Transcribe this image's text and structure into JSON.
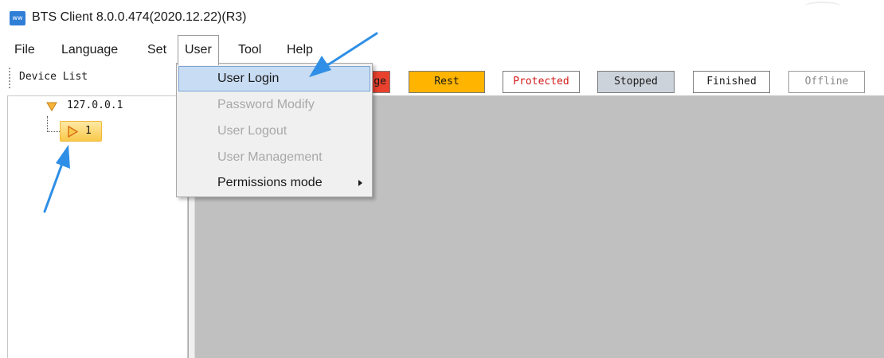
{
  "window": {
    "title": "BTS Client 8.0.0.474(2020.12.22)(R3)",
    "icon_label": "ww"
  },
  "menubar": {
    "file": "File",
    "language": "Language",
    "set": "Set",
    "user": "User",
    "tool": "Tool",
    "help": "Help"
  },
  "user_menu": {
    "items": [
      {
        "label": "User Login",
        "state": "highlighted"
      },
      {
        "label": "Password Modify",
        "state": "disabled"
      },
      {
        "label": "User Logout",
        "state": "disabled"
      },
      {
        "label": "User Management",
        "state": "disabled"
      },
      {
        "label": "Permissions mode",
        "state": "submenu"
      }
    ]
  },
  "toolbar": {
    "device_list": "Device List",
    "statuses": [
      {
        "label": "ge",
        "color": "#e8412e",
        "text_color": "#1a1a1a"
      },
      {
        "label": "Rest",
        "color": "#ffb400",
        "text_color": "#1a1a1a"
      },
      {
        "label": "Protected",
        "color": "#ffffff",
        "text_color": "#d11a1a"
      },
      {
        "label": "Stopped",
        "color": "#cdd3db",
        "text_color": "#1a1a1a"
      },
      {
        "label": "Finished",
        "color": "#ffffff",
        "text_color": "#1a1a1a"
      },
      {
        "label": "Offline",
        "color": "#ffffff",
        "text_color": "#8a8a8a"
      }
    ]
  },
  "device_tree": {
    "host": "127.0.0.1",
    "device": "1"
  },
  "colors": {
    "accent": "#2f8fe6",
    "content_background": "#c0c0c0",
    "menu_highlight": "#c8dcf3"
  },
  "icons": {
    "app": "bts-app-icon",
    "expander": "triangle-down-icon",
    "device": "play-triangle-icon",
    "submenu": "chevron-right-icon",
    "annotation": "blue-arrow-icon"
  }
}
